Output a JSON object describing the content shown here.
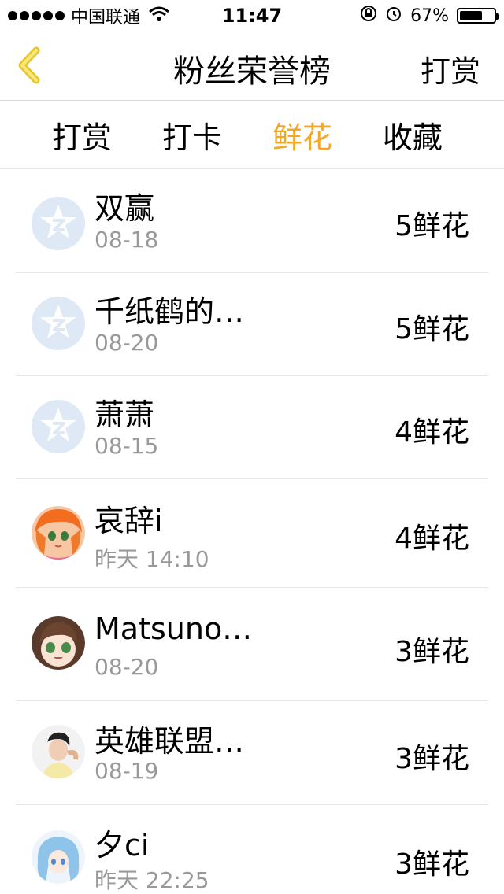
{
  "status_bar": {
    "carrier": "中国联通",
    "time": "11:47",
    "battery_percent": "67%",
    "battery_level": 0.67
  },
  "nav": {
    "title": "粉丝荣誉榜",
    "right_button": "打赏",
    "accent_color": "#f5d842"
  },
  "tabs": [
    {
      "label": "打赏",
      "active": false
    },
    {
      "label": "打卡",
      "active": false
    },
    {
      "label": "鲜花",
      "active": true
    },
    {
      "label": "收藏",
      "active": false
    }
  ],
  "accent_color": "#f5a623",
  "list": [
    {
      "name": "双赢",
      "date": "08-18",
      "count": "5鲜花",
      "avatar": "default-avatar-icon"
    },
    {
      "name": "千纸鹤的…",
      "date": "08-20",
      "count": "5鲜花",
      "avatar": "default-avatar-icon"
    },
    {
      "name": "萧萧",
      "date": "08-15",
      "count": "4鲜花",
      "avatar": "default-avatar-icon"
    },
    {
      "name": "哀辞i",
      "date": "昨天 14:10",
      "count": "4鲜花",
      "avatar": "anime-avatar"
    },
    {
      "name": "Matsuno…",
      "date": "08-20",
      "count": "3鲜花",
      "avatar": "anime-avatar"
    },
    {
      "name": "英雄联盟…",
      "date": "08-19",
      "count": "3鲜花",
      "avatar": "photo-avatar"
    },
    {
      "name": "夕ci",
      "date": "昨天 22:25",
      "count": "3鲜花",
      "avatar": "anime-avatar"
    }
  ]
}
